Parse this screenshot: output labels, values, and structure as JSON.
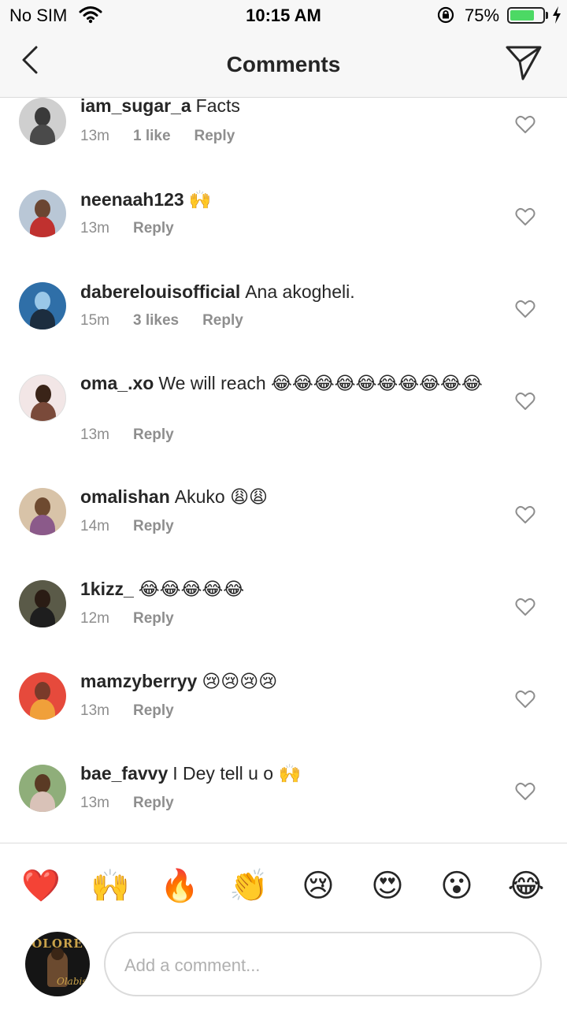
{
  "status_bar": {
    "carrier": "No SIM",
    "time": "10:15 AM",
    "battery": "75%",
    "battery_level": 0.75
  },
  "nav": {
    "title": "Comments",
    "back_icon": "chevron-left-icon",
    "send_icon": "paper-plane-icon"
  },
  "comments": [
    {
      "username": "iam_sugar_a",
      "text": "Facts",
      "time": "13m",
      "likes": "1 like",
      "reply": "Reply"
    },
    {
      "username": "neenaah123",
      "text": "🙌",
      "time": "13m",
      "likes": "",
      "reply": "Reply"
    },
    {
      "username": "daberelouisofficial",
      "text": "Ana akogheli.",
      "time": "15m",
      "likes": "3 likes",
      "reply": "Reply"
    },
    {
      "username": "oma_.xo",
      "text": "We will reach 😂😂😂😂😂😂😂😂😂😂",
      "time": "13m",
      "likes": "",
      "reply": "Reply"
    },
    {
      "username": "omalishan",
      "text": "Akuko 😩😩",
      "time": "14m",
      "likes": "",
      "reply": "Reply"
    },
    {
      "username": "1kizz_",
      "text": "😂😂😂😂😂",
      "time": "12m",
      "likes": "",
      "reply": "Reply"
    },
    {
      "username": "mamzyberryy",
      "text": "😢😢😢😢",
      "time": "13m",
      "likes": "",
      "reply": "Reply"
    },
    {
      "username": "bae_favvy",
      "text": "I Dey tell u o 🙌",
      "time": "13m",
      "likes": "",
      "reply": "Reply"
    }
  ],
  "quick_emojis": [
    "❤️",
    "🙌",
    "🔥",
    "👏",
    "😢",
    "😍",
    "😮",
    "😂"
  ],
  "composer": {
    "placeholder": "Add a comment...",
    "avatar_text": "OLORE",
    "avatar_script": "Olabiss"
  },
  "colors": {
    "text": "#262626",
    "meta": "#8e8e8e",
    "divider": "#dbdbdb",
    "battery": "#4cd964"
  }
}
